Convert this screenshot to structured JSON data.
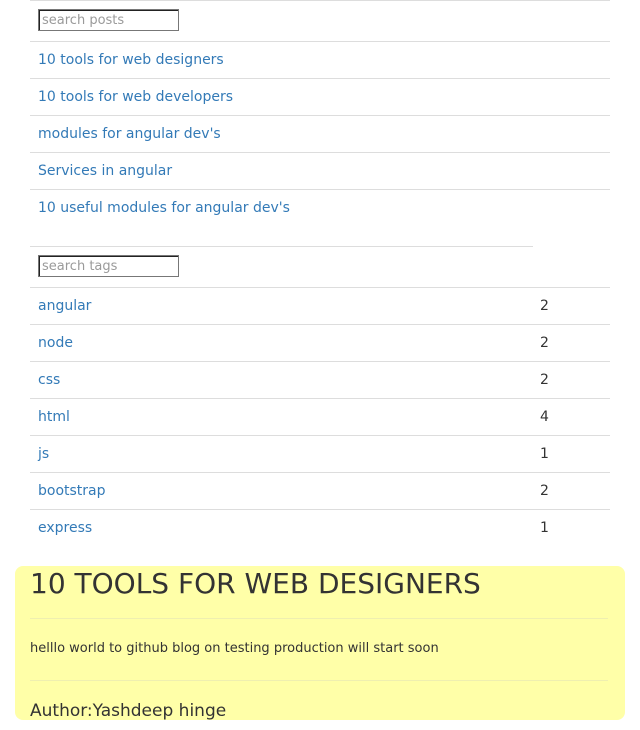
{
  "posts": {
    "search_placeholder": "search posts",
    "items": [
      {
        "title": "10 tools for web designers"
      },
      {
        "title": "10 tools for web developers"
      },
      {
        "title": "modules for angular dev's"
      },
      {
        "title": "Services in angular"
      },
      {
        "title": "10 useful modules for angular dev's"
      }
    ]
  },
  "tags": {
    "search_placeholder": "search tags",
    "items": [
      {
        "name": "angular",
        "count": "2"
      },
      {
        "name": "node",
        "count": "2"
      },
      {
        "name": "css",
        "count": "2"
      },
      {
        "name": "html",
        "count": "4"
      },
      {
        "name": "js",
        "count": "1"
      },
      {
        "name": "bootstrap",
        "count": "2"
      },
      {
        "name": "express",
        "count": "1"
      }
    ]
  },
  "post": {
    "title": "10 TOOLS FOR WEB DESIGNERS",
    "body": "helllo world to github blog on testing production will start soon",
    "author_label": "Author:",
    "author_name": "Yashdeep hinge",
    "background_color": "#ffffa8"
  },
  "colors": {
    "link": "#337ab7",
    "text": "#333333",
    "divider": "#dddddd"
  }
}
